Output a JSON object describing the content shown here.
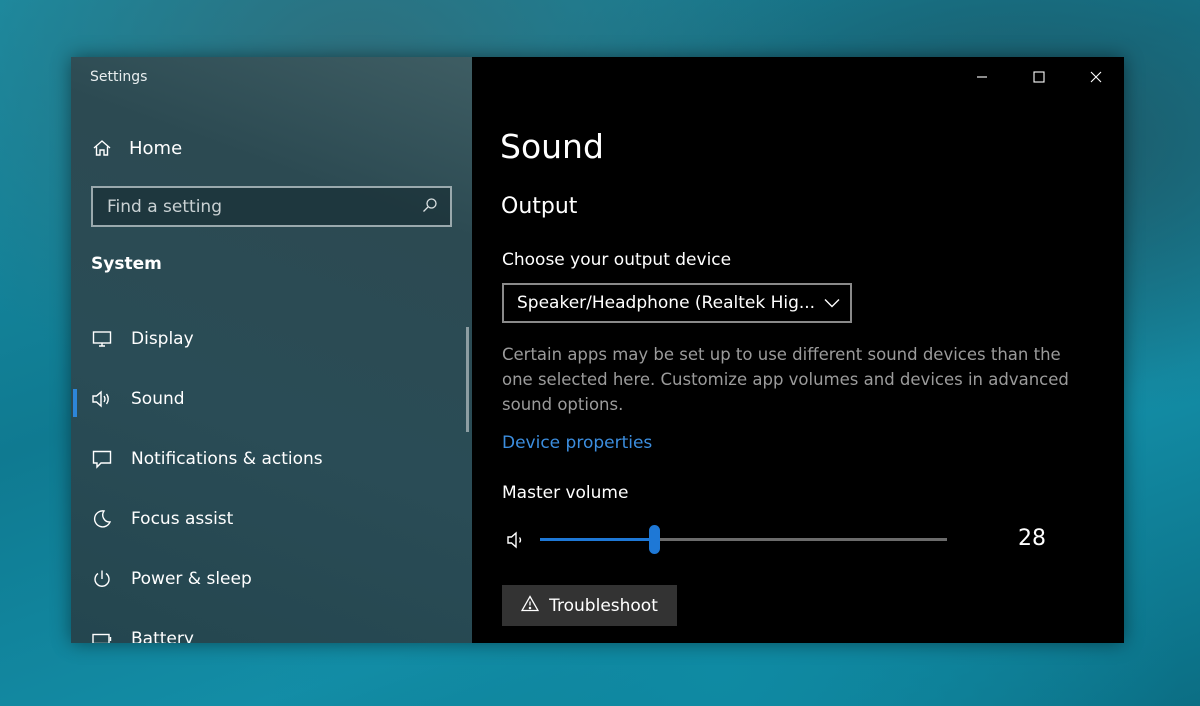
{
  "window": {
    "title": "Settings"
  },
  "sidebar": {
    "home_label": "Home",
    "search_placeholder": "Find a setting",
    "section": "System",
    "items": [
      {
        "label": "Display",
        "icon": "monitor-icon"
      },
      {
        "label": "Sound",
        "icon": "speaker-icon",
        "active": true
      },
      {
        "label": "Notifications & actions",
        "icon": "notification-icon"
      },
      {
        "label": "Focus assist",
        "icon": "moon-icon"
      },
      {
        "label": "Power & sleep",
        "icon": "power-icon"
      },
      {
        "label": "Battery",
        "icon": "battery-icon"
      }
    ]
  },
  "main": {
    "title": "Sound",
    "subtitle": "Output",
    "device_label": "Choose your output device",
    "device_selected": "Speaker/Headphone (Realtek Hig...",
    "description": "Certain apps may be set up to use different sound devices than the one selected here. Customize app volumes and devices in advanced sound options.",
    "link": "Device properties",
    "volume_label": "Master volume",
    "volume_value": "28",
    "volume_percent": 28,
    "troubleshoot_label": "Troubleshoot"
  },
  "colors": {
    "accent": "#1e78d6",
    "link": "#3c8edf"
  }
}
